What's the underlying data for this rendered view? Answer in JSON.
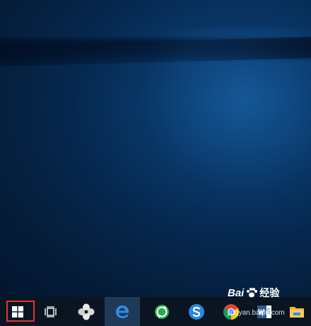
{
  "watermark": {
    "brand": "Bai",
    "brand2": "经验",
    "site": "jingyan.baidu.com"
  },
  "taskbar": {
    "items": [
      {
        "name": "start-button",
        "icon": "windows-icon"
      },
      {
        "name": "task-view-button",
        "icon": "task-view-icon"
      },
      {
        "name": "app-pinwheel",
        "icon": "pinwheel-icon"
      },
      {
        "name": "edge-browser",
        "icon": "edge-icon",
        "active": true
      },
      {
        "name": "360-browser",
        "icon": "refresh-globe-icon"
      },
      {
        "name": "sogou-browser",
        "icon": "sogou-s-icon"
      },
      {
        "name": "chrome-browser",
        "icon": "chrome-icon"
      },
      {
        "name": "word-app",
        "icon": "word-icon"
      },
      {
        "name": "file-explorer",
        "icon": "folder-icon"
      }
    ]
  },
  "colors": {
    "taskbar": "#0b1522",
    "highlight": "#e03535",
    "desktop": "#062a52"
  }
}
